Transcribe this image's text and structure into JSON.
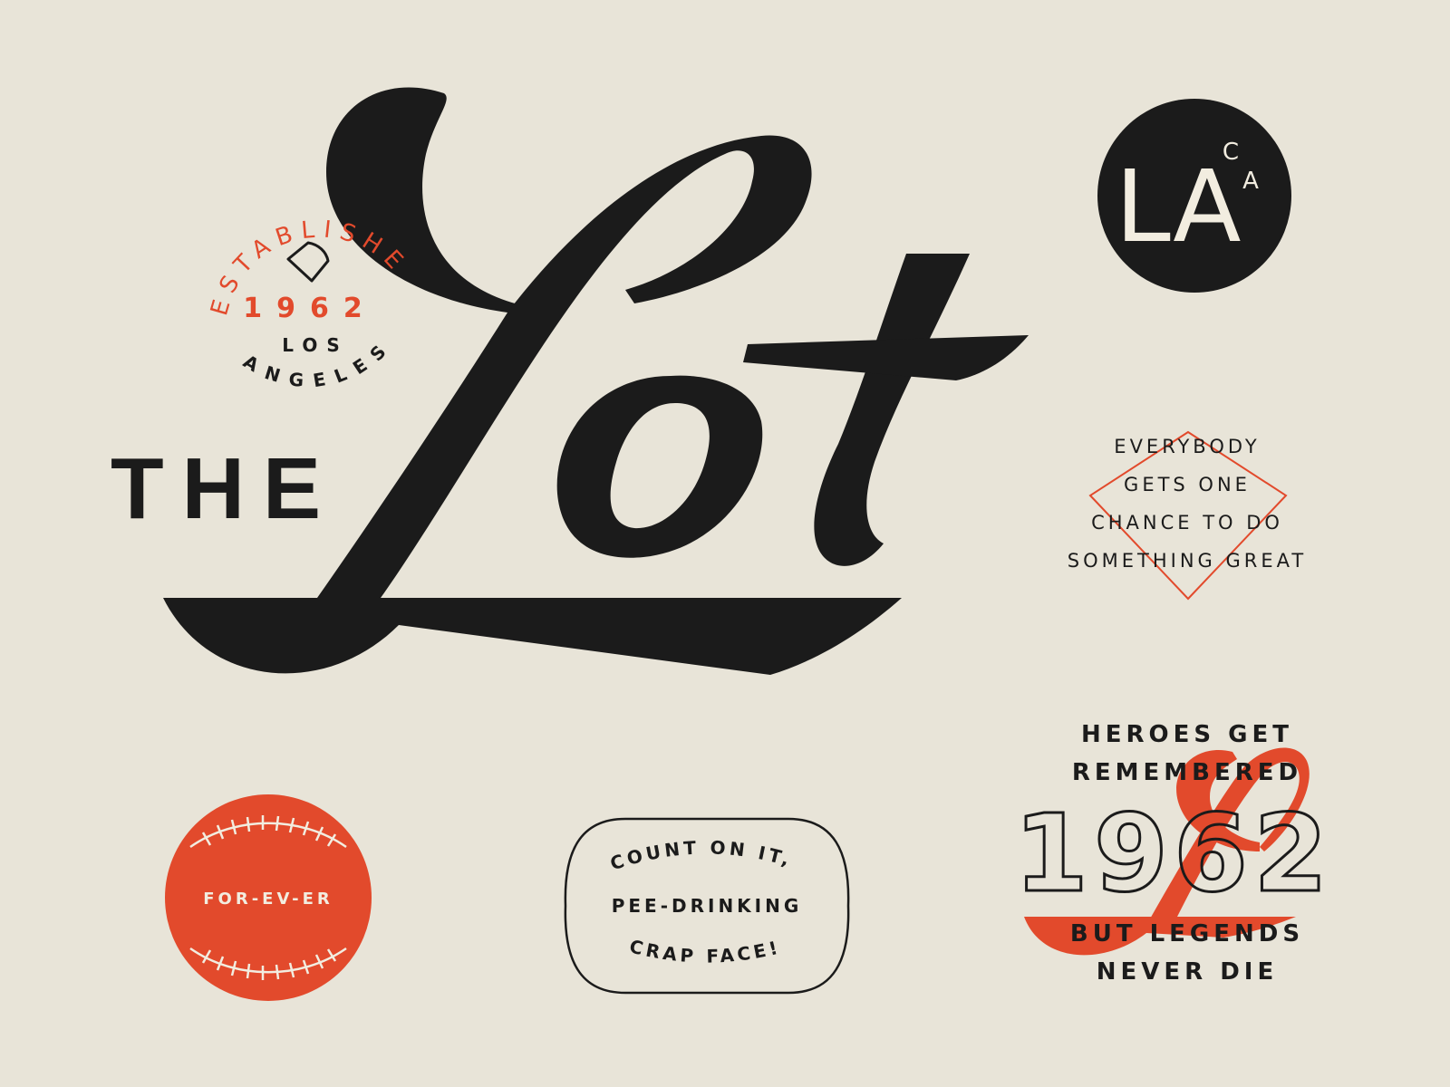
{
  "title": {
    "the": "THE",
    "script_word": "Lot"
  },
  "established_badge": {
    "arc_text": "ESTABLISHED",
    "year": "1962",
    "city_line1": "LOS",
    "city_line2": "ANGELES"
  },
  "la_monogram": {
    "main": "LA",
    "state_c": "C",
    "state_a": "A"
  },
  "quote": {
    "lines": [
      "EVERYBODY",
      "GETS ONE",
      "CHANCE TO DO",
      "SOMETHING GREAT"
    ]
  },
  "baseball_badge": {
    "text": "FOR-EV-ER"
  },
  "speech_badge": {
    "line1": "COUNT ON IT,",
    "line2": "PEE-DRINKING",
    "line3": "CRAP FACE!"
  },
  "heroes_lockup": {
    "line1": "HEROES GET",
    "line2": "REMEMBERED",
    "year": "1962",
    "line3": "BUT LEGENDS",
    "line4": "NEVER DIE"
  },
  "colors": {
    "background": "#e8e4d8",
    "ink": "#1b1b1b",
    "accent": "#e24a2c",
    "cream": "#f2ede0"
  }
}
